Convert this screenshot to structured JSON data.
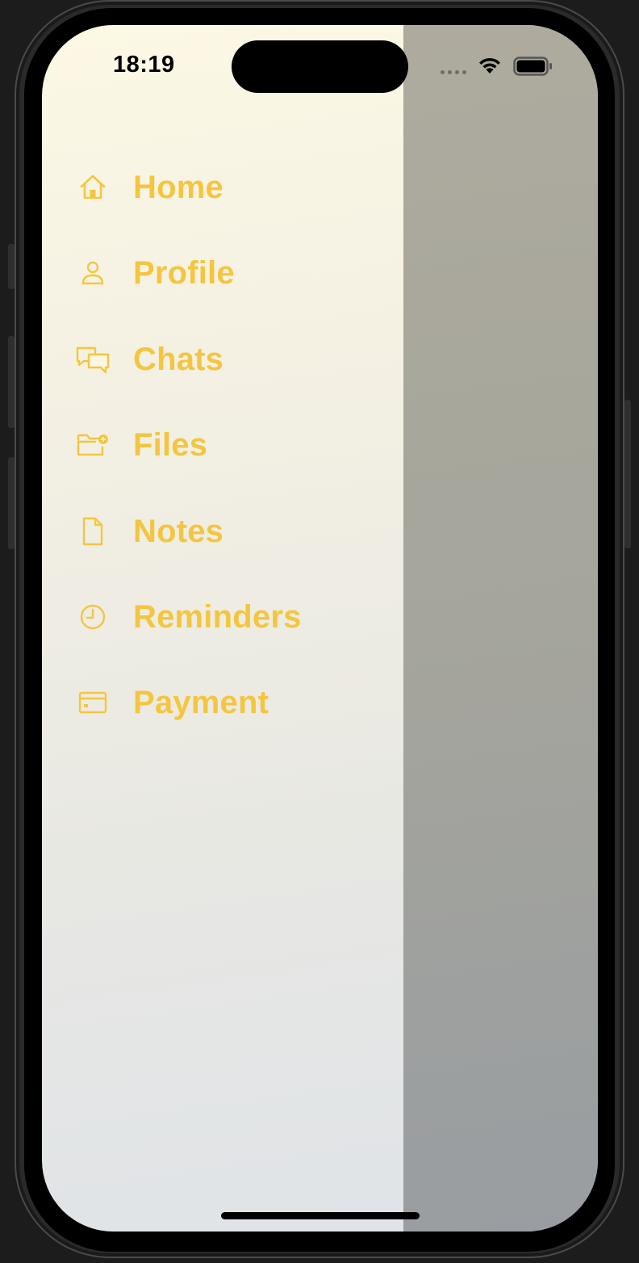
{
  "status_bar": {
    "time": "18:19",
    "icons": [
      "cellular-signal-icon",
      "wifi-icon",
      "battery-icon"
    ]
  },
  "menu": {
    "accent_color": "#f4c640",
    "items": [
      {
        "label": "Home",
        "icon": "home-icon"
      },
      {
        "label": "Profile",
        "icon": "person-icon"
      },
      {
        "label": "Chats",
        "icon": "chat-bubbles-icon"
      },
      {
        "label": "Files",
        "icon": "folder-add-icon"
      },
      {
        "label": "Notes",
        "icon": "document-icon"
      },
      {
        "label": "Reminders",
        "icon": "clock-icon"
      },
      {
        "label": "Payment",
        "icon": "credit-card-icon"
      }
    ]
  },
  "overlay": {
    "color": "#a6a59d"
  }
}
